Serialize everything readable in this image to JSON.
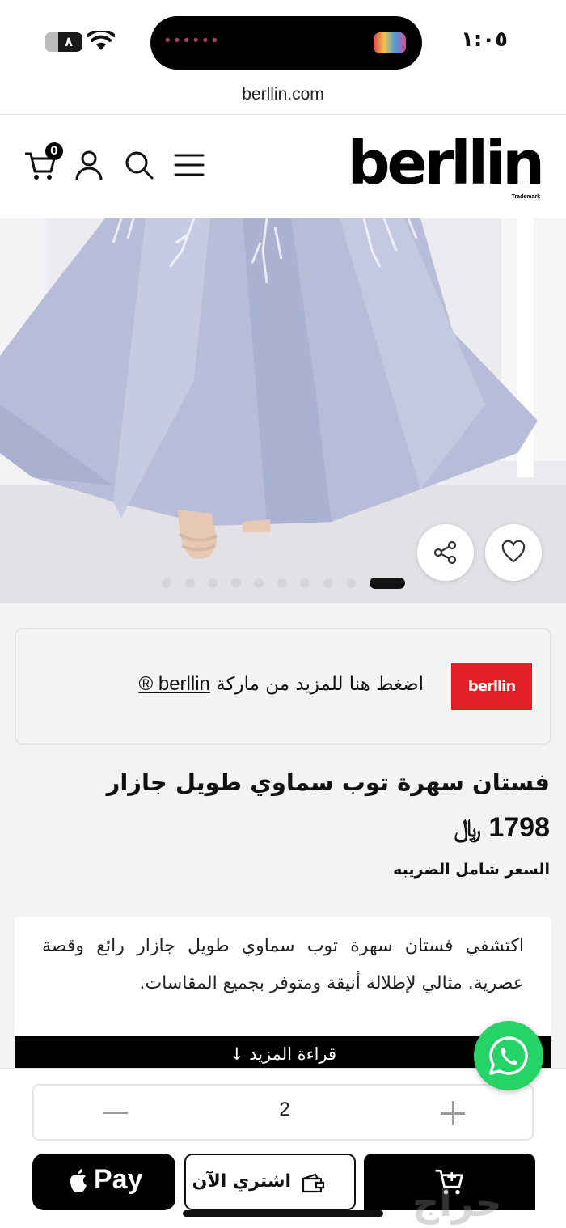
{
  "status_bar": {
    "time": "١:٠٥",
    "battery": "٨"
  },
  "browser": {
    "url": "berllin.com"
  },
  "header": {
    "logo": "berllin",
    "logo_tag": "Trademark",
    "cart_count": "0"
  },
  "gallery": {
    "slide_count": 10,
    "active_slide": 1
  },
  "brand_box": {
    "logo_text": "berllin",
    "prompt": "اضغط هنا للمزيد من ماركة",
    "link": "berllin ®"
  },
  "product": {
    "title": "فستان سهرة توب سماوي طويل جازار",
    "price": "1798",
    "currency": "﷼",
    "tax_note": "السعر شامل الضريبه",
    "description": "اكتشفي فستان سهرة توب سماوي طويل جازار رائع وقصة عصرية. مثالي لإطلالة أنيقة ومتوفر بجميع المقاسات.",
    "read_more": "قراءة المزيد ↓"
  },
  "purchase": {
    "quantity": "2",
    "apple_pay_label": "Pay",
    "buy_now_label": "اشتري الآن"
  },
  "watermark": "حراج"
}
